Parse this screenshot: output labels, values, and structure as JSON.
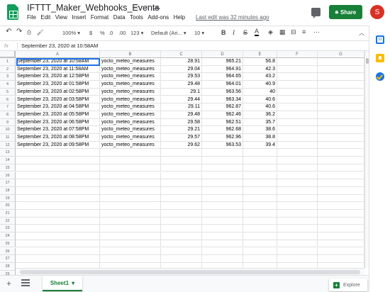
{
  "header": {
    "title": "IFTTT_Maker_Webhooks_Events",
    "menu": [
      "File",
      "Edit",
      "View",
      "Insert",
      "Format",
      "Data",
      "Tools",
      "Add-ons",
      "Help"
    ],
    "last_edit": "Last edit was 32 minutes ago",
    "share_label": "Share",
    "avatar_letter": "S"
  },
  "toolbar": {
    "zoom": "100%",
    "currency": "$",
    "percent": "%",
    "decimal_decrease": ".0",
    "decimal_increase": ".00",
    "more_formats": "123",
    "font": "Default (Ari...",
    "font_size": "10",
    "bold": "B",
    "italic": "I",
    "strike": "S",
    "text_color": "A"
  },
  "formula_bar": {
    "fx": "fx",
    "value": "September 23, 2020 at 10:58AM"
  },
  "columns": [
    "A",
    "B",
    "C",
    "D",
    "E",
    "F",
    "G"
  ],
  "rows": [
    [
      "September 23, 2020 at 10:58AM",
      "yocto_meteo_measures",
      "28.91",
      "965.21",
      "56.8"
    ],
    [
      "September 23, 2020 at 11:58AM",
      "yocto_meteo_measures",
      "29.04",
      "964.91",
      "42.3"
    ],
    [
      "September 23, 2020 at 12:58PM",
      "yocto_meteo_measures",
      "29.53",
      "964.65",
      "43.2"
    ],
    [
      "September 23, 2020 at 01:58PM",
      "yocto_meteo_measures",
      "29.48",
      "964.01",
      "40.9"
    ],
    [
      "September 23, 2020 at 02:58PM",
      "yocto_meteo_measures",
      "29.1",
      "963.56",
      "40"
    ],
    [
      "September 23, 2020 at 03:58PM",
      "yocto_meteo_measures",
      "29.44",
      "963.34",
      "40.6"
    ],
    [
      "September 23, 2020 at 04:58PM",
      "yocto_meteo_measures",
      "29.11",
      "962.87",
      "40.6"
    ],
    [
      "September 23, 2020 at 05:58PM",
      "yocto_meteo_measures",
      "29.48",
      "962.46",
      "36.2"
    ],
    [
      "September 23, 2020 at 06:58PM",
      "yocto_meteo_measures",
      "29.58",
      "962.51",
      "35.7"
    ],
    [
      "September 23, 2020 at 07:58PM",
      "yocto_meteo_measures",
      "29.21",
      "962.68",
      "38.6"
    ],
    [
      "September 23, 2020 at 08:58PM",
      "yocto_meteo_measures",
      "29.57",
      "962.96",
      "38.8"
    ],
    [
      "September 23, 2020 at 09:58PM",
      "yocto_meteo_measures",
      "29.62",
      "963.53",
      "39.4"
    ]
  ],
  "row_count": 29,
  "sheet": {
    "add_label": "+",
    "tab_label": "Sheet1",
    "explore_label": "Explore"
  },
  "side_panel": [
    "calendar-icon",
    "keep-icon",
    "tasks-icon"
  ]
}
